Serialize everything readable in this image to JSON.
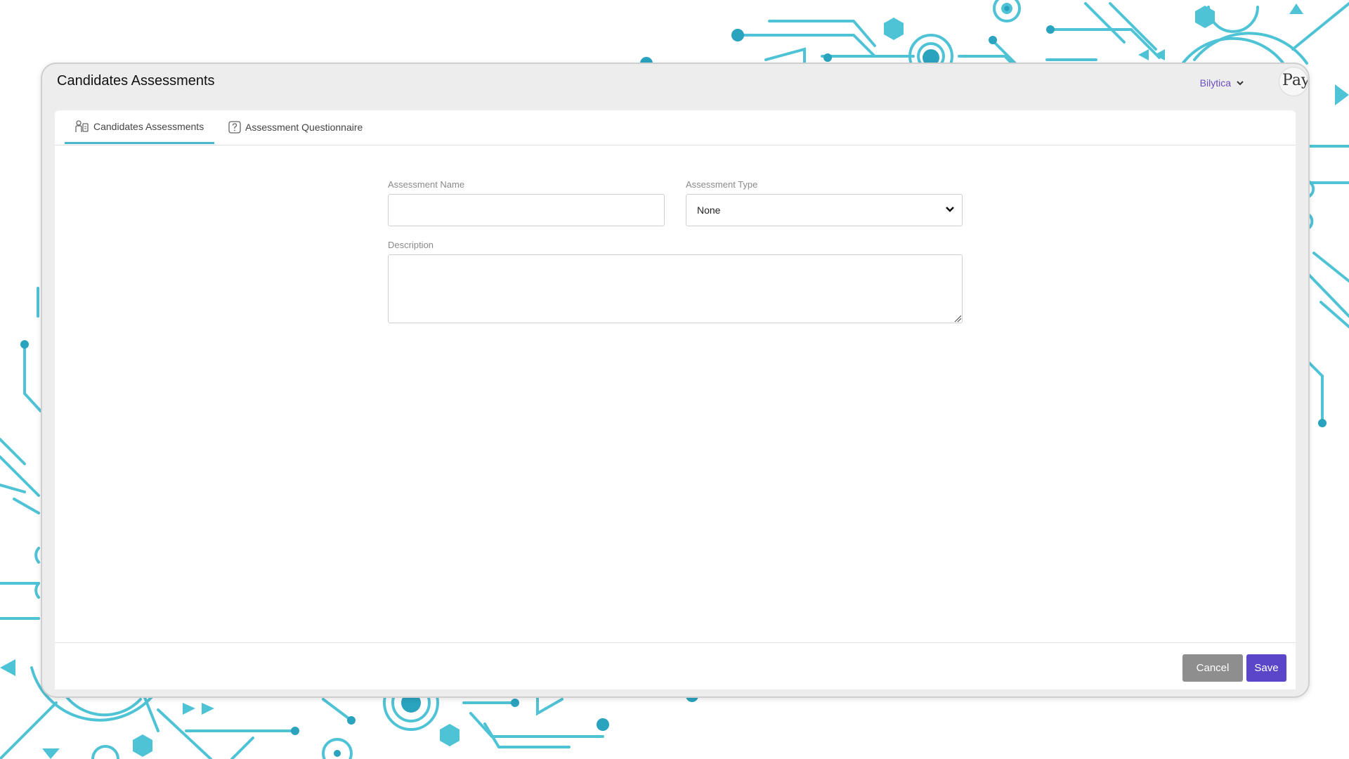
{
  "window": {
    "title": "Candidates Assessments"
  },
  "header": {
    "org_name": "Bilytica",
    "org_chevron_icon": "chevron-down-icon",
    "logo_text": "Pay"
  },
  "tabs": [
    {
      "label": "Candidates Assessments",
      "icon": "assessment-people-icon",
      "active": true
    },
    {
      "label": "Assessment Questionnaire",
      "icon": "question-box-icon",
      "active": false
    }
  ],
  "form": {
    "assessment_name": {
      "label": "Assessment Name",
      "value": ""
    },
    "assessment_type": {
      "label": "Assessment Type",
      "selected": "None"
    },
    "description": {
      "label": "Description",
      "value": ""
    }
  },
  "footer": {
    "cancel_label": "Cancel",
    "save_label": "Save"
  },
  "colors": {
    "accent": "#4ab6c9",
    "primary_button": "#5b45c9",
    "secondary_button": "#8e8e8e",
    "org_link": "#6b4ec2",
    "background_decor": "#4fc3d6"
  }
}
